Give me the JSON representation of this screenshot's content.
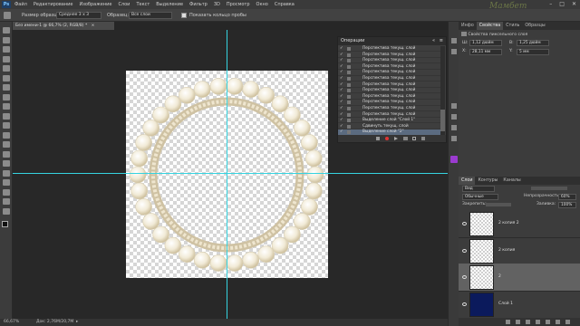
{
  "app": {
    "logo": "Ps"
  },
  "menubar": {
    "items": [
      "Файл",
      "Редактирование",
      "Изображение",
      "Слои",
      "Текст",
      "Выделение",
      "Фильтр",
      "3D",
      "Просмотр",
      "Окно",
      "Справка"
    ],
    "controls": [
      "–",
      "□",
      "✕"
    ],
    "watermark": "Мамбет"
  },
  "options": {
    "sample_size_label": "Размер образца:",
    "sample_size_value": "Среднее 3 x 3",
    "sample_label": "Образец:",
    "sample_value": "Все слои",
    "show_ring_label": "Показать кольцо пробы"
  },
  "document": {
    "tab_label": "Без имени-1 @ 66,7% (2, RGB/8) *",
    "tab_close": "×"
  },
  "status": {
    "zoom": "66,67%",
    "doc_info": "Док: 2,76M/20,7M",
    "arrow": "▸"
  },
  "operations": {
    "title": "Операции",
    "rows": [
      {
        "label": "Перспектива текущ. слой",
        "selected": false
      },
      {
        "label": "Перспектива текущ. слой",
        "selected": false
      },
      {
        "label": "Перспектива текущ. слой",
        "selected": false
      },
      {
        "label": "Перспектива текущ. слой",
        "selected": false
      },
      {
        "label": "Перспектива текущ. слой",
        "selected": false
      },
      {
        "label": "Перспектива текущ. слой",
        "selected": false
      },
      {
        "label": "Перспектива текущ. слой",
        "selected": false
      },
      {
        "label": "Перспектива текущ. слой",
        "selected": false
      },
      {
        "label": "Перспектива текущ. слой",
        "selected": false
      },
      {
        "label": "Перспектива текущ. слой",
        "selected": false
      },
      {
        "label": "Перспектива текущ. слой",
        "selected": false
      },
      {
        "label": "Перспектива текущ. слой",
        "selected": false
      },
      {
        "label": "Выделение слой \"Слой 1\"",
        "selected": false
      },
      {
        "label": "Сдвинуть текущ. слой",
        "selected": false
      },
      {
        "label": "Выделение слой \"2\"",
        "selected": true
      }
    ],
    "checkmark": "✓",
    "panel_controls": [
      "«",
      "≡"
    ]
  },
  "right_top": {
    "tabs": [
      "Инфо",
      "Свойства",
      "Стиль",
      "Образцы"
    ],
    "active_tab": "Свойства",
    "title": "Свойства пиксельного слоя",
    "w_label": "Ш:",
    "w_value": "1,12 дюйм",
    "h_label": "В:",
    "h_value": "1,25 дюйм",
    "x_label": "X:",
    "x_value": "28,11 мм",
    "y_label": "Y:",
    "y_value": "5 мм"
  },
  "layers_panel": {
    "tabs": [
      "Слои",
      "Контуры",
      "Каналы"
    ],
    "active_tab": "Слои",
    "filter_value": "Вид",
    "blend_mode": "Обычные",
    "opacity_label": "Непрозрачность:",
    "opacity_value": "60%",
    "lock_label": "Закрепить:",
    "fill_label": "Заливка:",
    "fill_value": "100%",
    "layers": [
      {
        "name": "2 копия 2",
        "active": false,
        "fill": "transparent"
      },
      {
        "name": "2 копия",
        "active": false,
        "fill": "transparent"
      },
      {
        "name": "2",
        "active": true,
        "fill": "transparent"
      },
      {
        "name": "Слой 1",
        "active": false,
        "fill": "#0b1a5c"
      }
    ],
    "footer_icons": [
      "link-icon",
      "fx-icon",
      "mask-icon",
      "adjustment-icon",
      "folder-icon",
      "new-layer-icon",
      "trash-icon"
    ]
  },
  "colors": {
    "guide": "#35d3e0",
    "pearl": "#f2ecdc",
    "rope": "#d8ccae",
    "navy": "#0b1a5c"
  }
}
